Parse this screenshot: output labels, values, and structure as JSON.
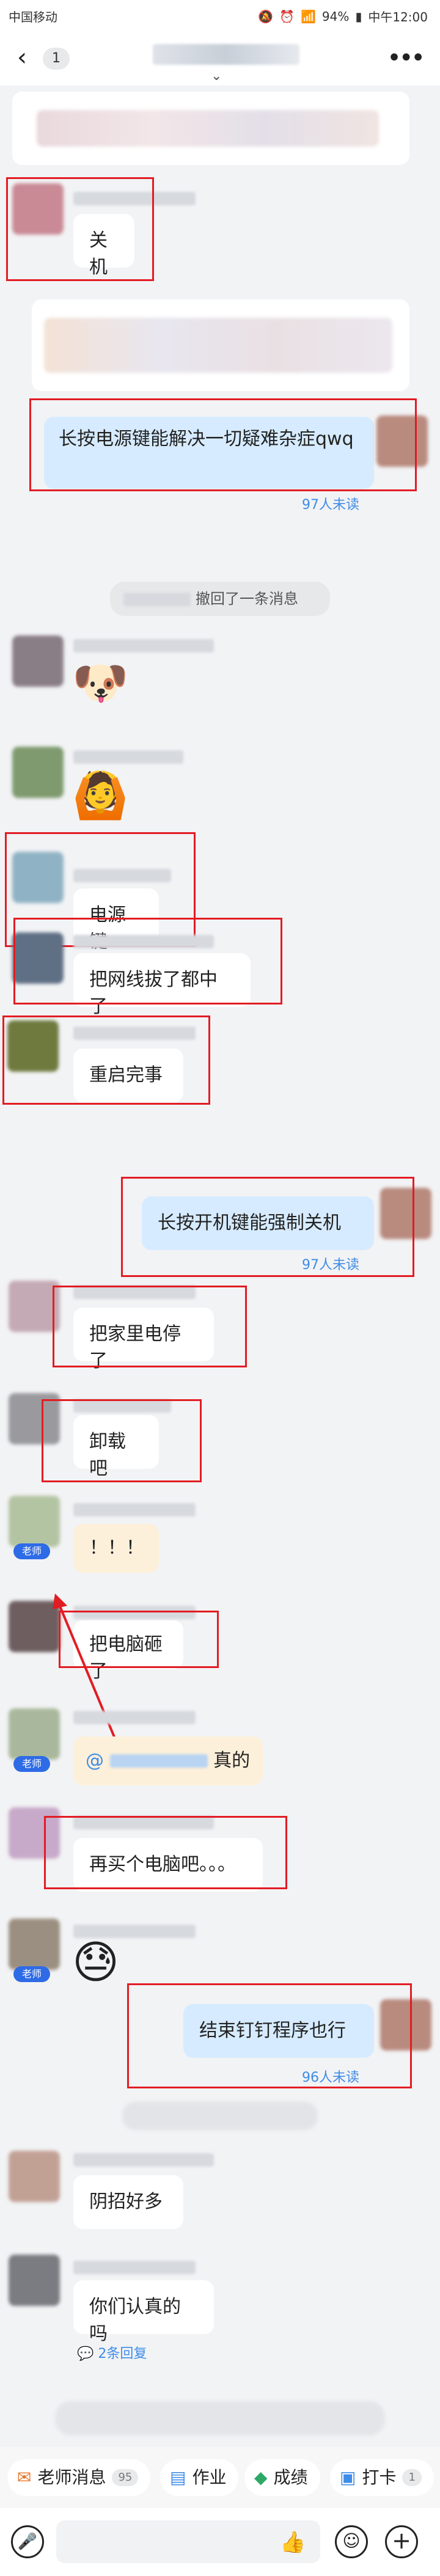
{
  "status_bar": {
    "carrier": "中国移动",
    "battery": "94%",
    "time": "中午12:00",
    "icons": [
      "mute-icon",
      "alarm-icon",
      "wifi-icon",
      "signal-icon",
      "battery-icon"
    ]
  },
  "nav": {
    "back_icon": "chevron-left-icon",
    "unread_count": "1",
    "more_icon": "more-dots-icon"
  },
  "messages": [
    {
      "id": "m1",
      "text": "关机"
    },
    {
      "id": "m2",
      "text": "长按电源键能解决一切疑难杂症qwq",
      "unread": "97人未读"
    },
    {
      "id": "sys1",
      "text": "撤回了一条消息"
    },
    {
      "id": "m3",
      "text": "电源键"
    },
    {
      "id": "m4",
      "text": "把网线拔了都中了"
    },
    {
      "id": "m5",
      "text": "重启完事"
    },
    {
      "id": "m6",
      "text": "长按开机键能强制关机",
      "unread": "97人未读"
    },
    {
      "id": "m7",
      "text": "把家里电停了"
    },
    {
      "id": "m8",
      "text": "卸载吧"
    },
    {
      "id": "m9",
      "text": "！！！"
    },
    {
      "id": "m10",
      "text": "把电脑砸了"
    },
    {
      "id": "m11",
      "text": "@",
      "suffix": "真的"
    },
    {
      "id": "m12",
      "text": "再买个电脑吧。。。"
    },
    {
      "id": "m13",
      "text": "结束钉钉程序也行",
      "unread": "96人未读"
    },
    {
      "id": "m14",
      "text": "阴招好多"
    },
    {
      "id": "m15",
      "text": "你们认真的吗",
      "reply": "2条回复"
    }
  ],
  "teacher_tag": "老师",
  "bottom_tabs": [
    {
      "label": "老师消息",
      "count": "95",
      "icon": "teacher-message-icon",
      "color": "#e8762c"
    },
    {
      "label": "作业",
      "icon": "homework-icon",
      "color": "#3f8ce8"
    },
    {
      "label": "成绩",
      "icon": "grades-icon",
      "color": "#2ea866"
    },
    {
      "label": "打卡",
      "count": "1",
      "icon": "checkin-icon",
      "color": "#3f8ce8"
    }
  ],
  "input_bar": {
    "icons": [
      "microphone-icon",
      "thumbs-up-icon",
      "emoji-icon",
      "plus-icon"
    ]
  },
  "colors": {
    "highlight_box": "#e21c23",
    "my_bubble": "#d6ebff",
    "unread_text": "#3f8ce8",
    "teacher_tag": "#2e6be6"
  }
}
